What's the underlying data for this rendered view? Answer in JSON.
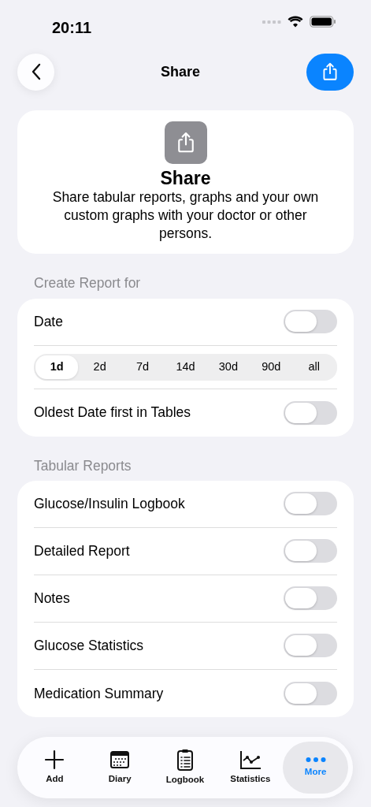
{
  "status_bar": {
    "time": "20:11"
  },
  "nav": {
    "title": "Share"
  },
  "intro": {
    "title": "Share",
    "text": "Share tabular reports, graphs and your own custom graphs with your doctor or other persons."
  },
  "sections": [
    {
      "header": "Create Report for",
      "rows": [
        {
          "kind": "toggle",
          "label": "Date",
          "on": false
        },
        {
          "kind": "segments",
          "segments": [
            {
              "label": "1d",
              "selected": true
            },
            {
              "label": "2d",
              "selected": false
            },
            {
              "label": "7d",
              "selected": false
            },
            {
              "label": "14d",
              "selected": false
            },
            {
              "label": "30d",
              "selected": false
            },
            {
              "label": "90d",
              "selected": false
            },
            {
              "label": "all",
              "selected": false
            }
          ]
        },
        {
          "kind": "toggle",
          "label": "Oldest Date first in Tables",
          "on": false
        }
      ]
    },
    {
      "header": "Tabular Reports",
      "rows": [
        {
          "kind": "toggle",
          "label": "Glucose/Insulin Logbook",
          "on": false
        },
        {
          "kind": "toggle",
          "label": "Detailed Report",
          "on": false
        },
        {
          "kind": "toggle",
          "label": "Notes",
          "on": false
        },
        {
          "kind": "toggle",
          "label": "Glucose Statistics",
          "on": false
        },
        {
          "kind": "toggle",
          "label": "Medication Summary",
          "on": false
        }
      ]
    }
  ],
  "tab_bar": [
    {
      "kind": "add",
      "label": "Add",
      "selected": false
    },
    {
      "kind": "diary",
      "label": "Diary",
      "selected": false
    },
    {
      "kind": "logbook",
      "label": "Logbook",
      "selected": false
    },
    {
      "kind": "statistics",
      "label": "Statistics",
      "selected": false
    },
    {
      "kind": "more",
      "label": "More",
      "selected": true
    }
  ]
}
